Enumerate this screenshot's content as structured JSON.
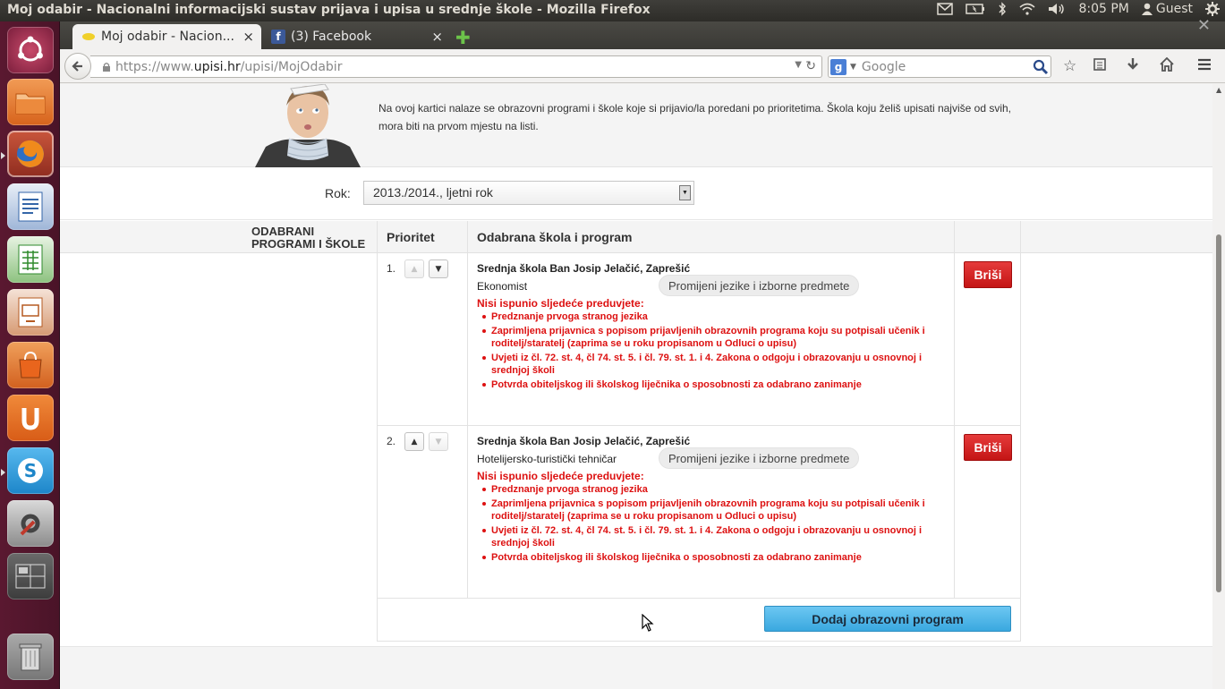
{
  "window": {
    "title": "Moj odabir - Nacionalni informacijski sustav prijava i upisa u srednje škole - Mozilla Firefox"
  },
  "panel": {
    "time": "8:05 PM",
    "user": "Guest"
  },
  "launcher": {
    "items": [
      "ubuntu-dash",
      "files",
      "firefox",
      "libreoffice-writer",
      "libreoffice-calc",
      "libreoffice-impress",
      "software-center",
      "ubuntu-one",
      "skype",
      "system-settings",
      "workspace-switcher",
      "trash"
    ]
  },
  "tabs": [
    {
      "label": "Moj odabir - Nacion...",
      "close": "×"
    },
    {
      "label": "(3) Facebook",
      "close": "×"
    }
  ],
  "tab_new": "✚",
  "url": {
    "scheme": "https://www.",
    "host": "upisi.hr",
    "path": "/upisi/MojOdabir"
  },
  "search": {
    "placeholder": "Google",
    "engine_letter": "g"
  },
  "page": {
    "intro": "Na ovoj kartici nalaze se obrazovni programi i škole koje si prijavio/la poredani po prioritetima. Škola koju želiš upisati najviše od svih, mora biti na prvom mjestu na listi.",
    "rok_label": "Rok:",
    "rok_value": "2013./2014., ljetni rok",
    "side_title": "ODABRANI PROGRAMI I ŠKOLE",
    "col_priority": "Prioritet",
    "col_school": "Odabrana škola i program",
    "change_label": "Promijeni jezike i izborne predmete",
    "req_title": "Nisi ispunio sljedeće preduvjete:",
    "delete_label": "Briši",
    "add_label": "Dodaj obrazovni program",
    "programs": [
      {
        "num": "1.",
        "school": "Srednja škola Ban Josip Jelačić, Zaprešić",
        "program": "Ekonomist",
        "requirements": [
          "Predznanje prvoga stranog jezika",
          "Zaprimljena prijavnica s popisom prijavljenih obrazovnih programa koju su potpisali učenik i roditelj/staratelj (zaprima se u roku propisanom u Odluci o upisu)",
          "Uvjeti iz čl. 72. st. 4, čl 74. st. 5. i čl. 79. st. 1. i 4. Zakona o odgoju i obrazovanju u osnovnoj i srednjoj školi",
          "Potvrda obiteljskog ili školskog liječnika o sposobnosti za odabrano zanimanje"
        ]
      },
      {
        "num": "2.",
        "school": "Srednja škola Ban Josip Jelačić, Zaprešić",
        "program": "Hotelijersko-turistički tehničar",
        "requirements": [
          "Predznanje prvoga stranog jezika",
          "Zaprimljena prijavnica s popisom prijavljenih obrazovnih programa koju su potpisali učenik i roditelj/staratelj (zaprima se u roku propisanom u Odluci o upisu)",
          "Uvjeti iz čl. 72. st. 4, čl 74. st. 5. i čl. 79. st. 1. i 4. Zakona o odgoju i obrazovanju u osnovnoj i srednjoj školi",
          "Potvrda obiteljskog ili školskog liječnika o sposobnosti za odabrano zanimanje"
        ]
      }
    ]
  },
  "colors": {
    "error": "#dd1111",
    "delete_button": "#d42020",
    "add_button": "#4db4e6",
    "launcher": "#5a1830"
  }
}
